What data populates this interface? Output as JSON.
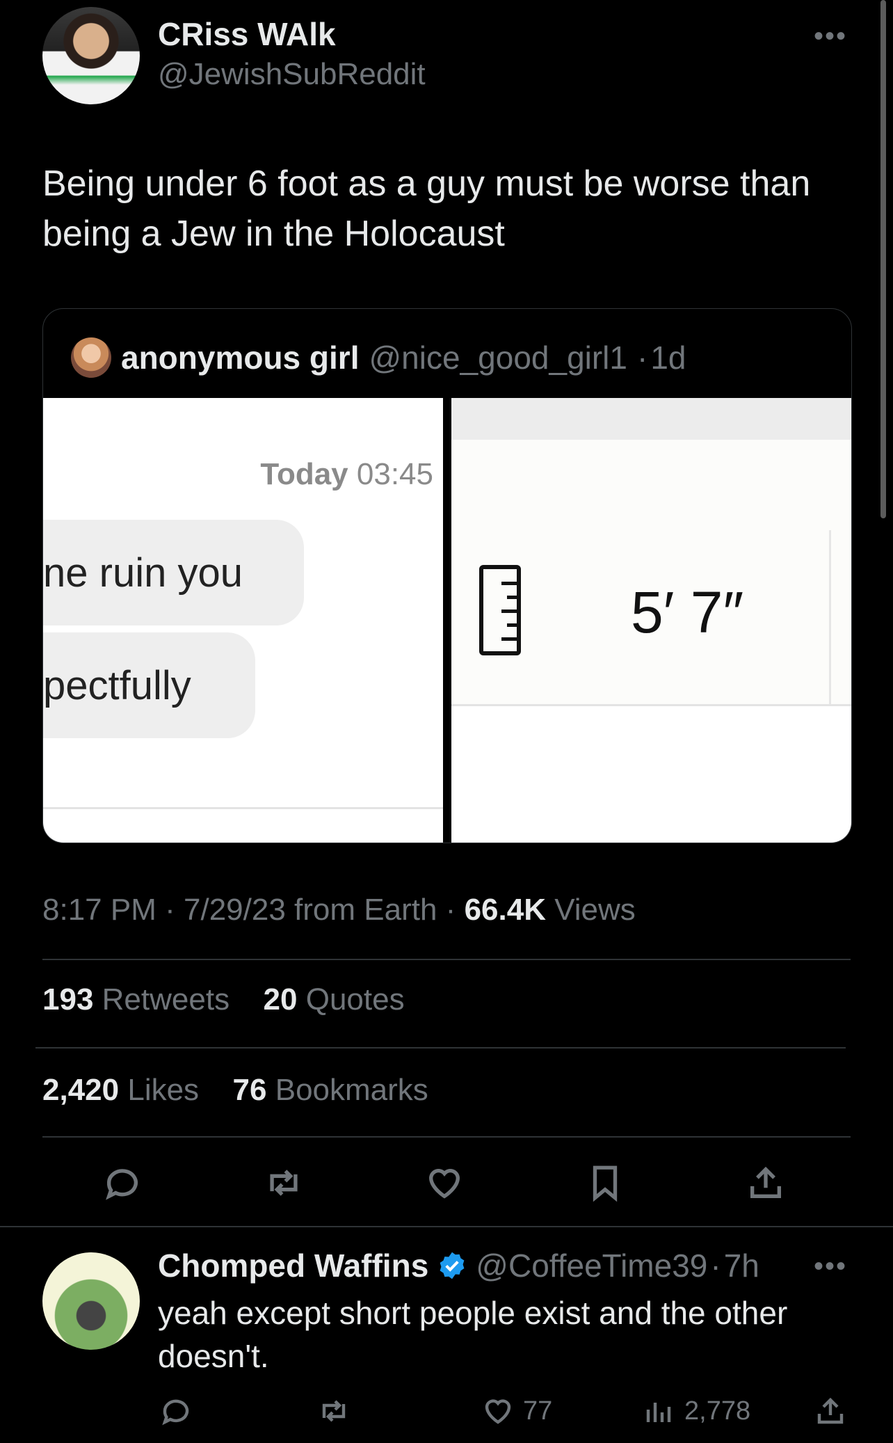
{
  "tweet": {
    "display_name": "CRiss WAlk",
    "handle": "@JewishSubReddit",
    "text": "Being under 6 foot as a guy must be worse than being a Jew in the Holocaust",
    "more": "•••",
    "quote": {
      "name": "anonymous girl",
      "handle": "@nice_good_girl1",
      "age": "1d",
      "left_image": {
        "day": "Today",
        "time": "03:45",
        "bubble1": "ne ruin you",
        "bubble2": "pectfully"
      },
      "right_image": {
        "icon": "ruler-icon",
        "height": "5′ 7″"
      }
    },
    "meta": {
      "time": "8:17 PM",
      "date": "7/29/23",
      "source": "from Earth",
      "views_count": "66.4K",
      "views_label": "Views"
    },
    "stats": {
      "retweets_count": "193",
      "retweets_label": "Retweets",
      "quotes_count": "20",
      "quotes_label": "Quotes",
      "likes_count": "2,420",
      "likes_label": "Likes",
      "bookmarks_count": "76",
      "bookmarks_label": "Bookmarks"
    },
    "actions": [
      "reply-icon",
      "retweet-icon",
      "like-icon",
      "bookmark-icon",
      "share-icon"
    ]
  },
  "reply": {
    "display_name": "Chomped Waffins",
    "handle": "@CoffeeTime39",
    "age": "7h",
    "text": "yeah except short people exist and the other doesn't.",
    "more": "•••",
    "likes": "77",
    "views": "2,778",
    "verified_color": "#1d9bf0"
  },
  "colors": {
    "background": "#000000",
    "text": "#e7e9ea",
    "secondary": "#71767b",
    "border": "#2f3336"
  }
}
